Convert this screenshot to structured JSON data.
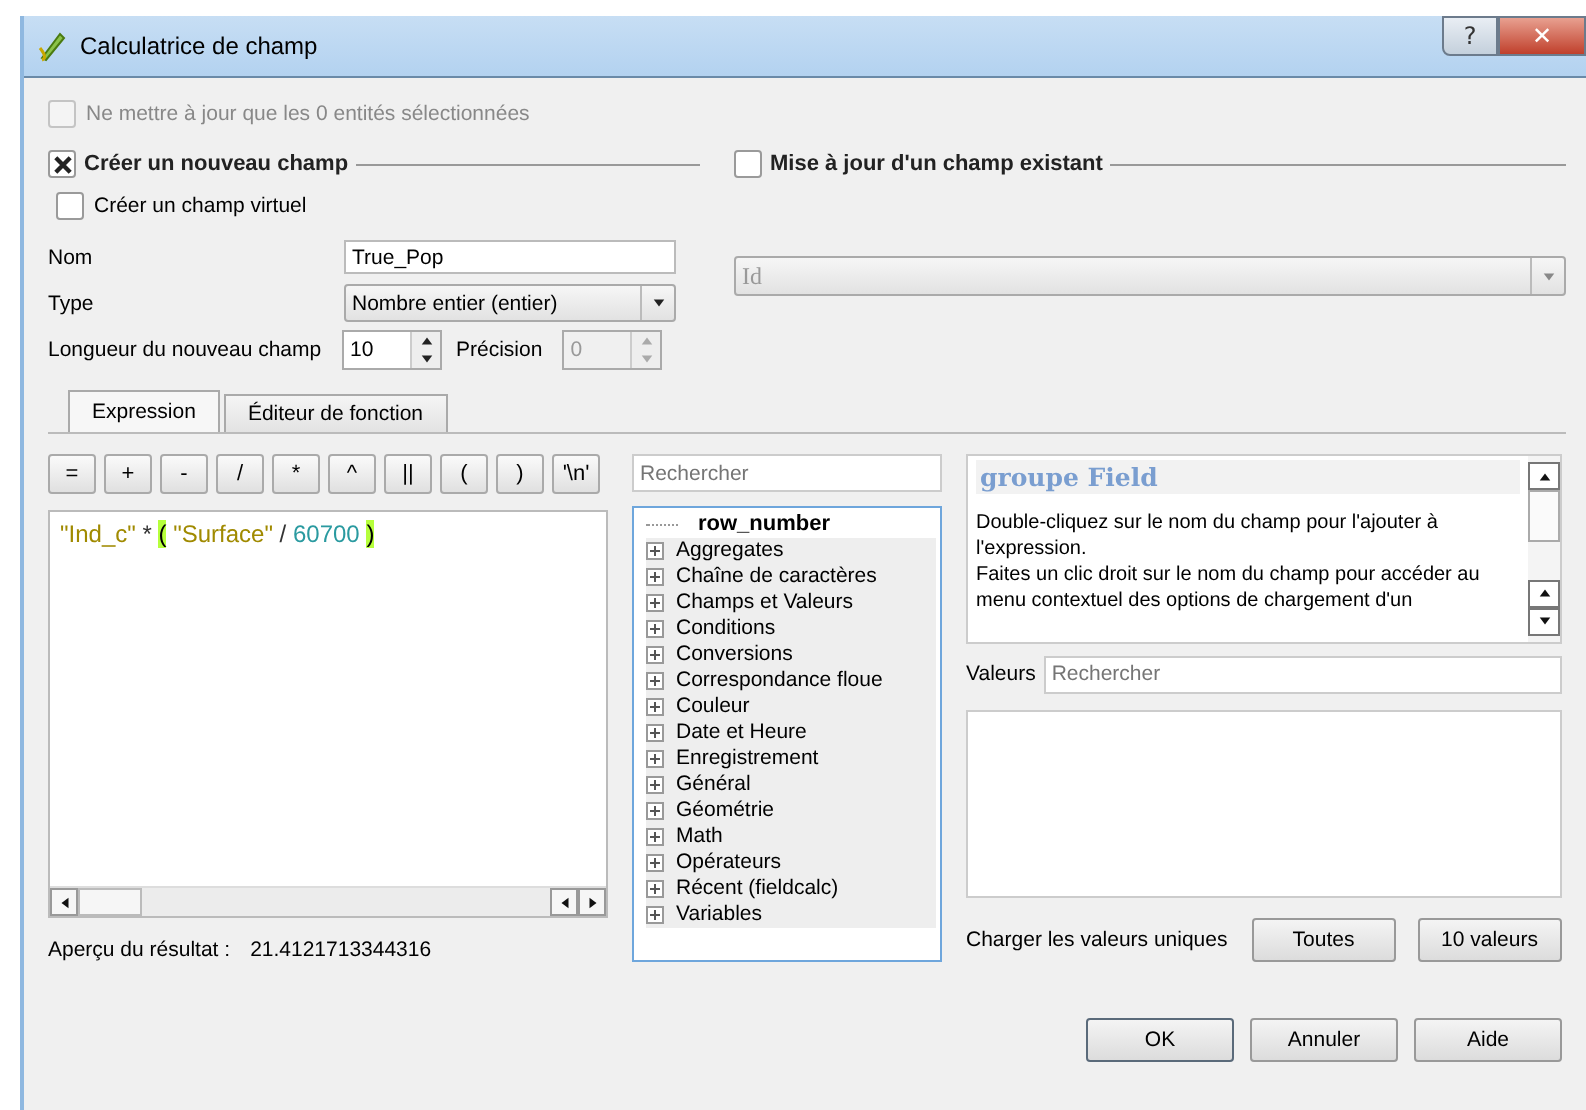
{
  "window": {
    "title": "Calculatrice de champ",
    "buttons": [
      {
        "kind": "help",
        "label": "?"
      },
      {
        "kind": "close",
        "label": "✕"
      }
    ]
  },
  "selected_only": {
    "label": "Ne mettre à jour que les 0 entités sélectionnées",
    "checked": false,
    "disabled": true
  },
  "new_field": {
    "label": "Créer un nouveau champ",
    "checked": true,
    "virtual": {
      "label": "Créer un champ virtuel",
      "checked": false
    },
    "name": {
      "label": "Nom",
      "value": "True_Pop"
    },
    "type": {
      "label": "Type",
      "value": "Nombre entier (entier)"
    },
    "length": {
      "label": "Longueur du nouveau champ",
      "value": "10"
    },
    "precision": {
      "label": "Précision",
      "value": "0",
      "disabled": true
    }
  },
  "update_field": {
    "label": "Mise à jour d'un champ existant",
    "checked": false,
    "field": {
      "value": "Id",
      "disabled": true
    }
  },
  "tabs": [
    {
      "label": "Expression",
      "selected": true
    },
    {
      "label": "Éditeur de fonction",
      "selected": false
    }
  ],
  "operators": [
    "=",
    "+",
    "-",
    "/",
    "*",
    "^",
    "||",
    "(",
    ")",
    "'\\n'"
  ],
  "expression": [
    {
      "kind": "field",
      "text": "\"Ind_c\""
    },
    {
      "kind": "op",
      "text": "*"
    },
    {
      "kind": "paren",
      "text": "("
    },
    {
      "kind": "field",
      "text": "\"Surface\""
    },
    {
      "kind": "op",
      "text": "/"
    },
    {
      "kind": "number",
      "text": "60700"
    },
    {
      "kind": "paren",
      "text": ")"
    }
  ],
  "preview": {
    "label": "Aperçu du résultat :",
    "value": "21.4121713344316"
  },
  "function_search": {
    "placeholder": "Rechercher"
  },
  "function_tree": [
    {
      "label": "row_number",
      "kind": "leaf"
    },
    {
      "label": "Aggregates",
      "kind": "group"
    },
    {
      "label": "Chaîne de caractères",
      "kind": "group"
    },
    {
      "label": "Champs et Valeurs",
      "kind": "group"
    },
    {
      "label": "Conditions",
      "kind": "group"
    },
    {
      "label": "Conversions",
      "kind": "group"
    },
    {
      "label": "Correspondance floue",
      "kind": "group"
    },
    {
      "label": "Couleur",
      "kind": "group"
    },
    {
      "label": "Date et Heure",
      "kind": "group"
    },
    {
      "label": "Enregistrement",
      "kind": "group"
    },
    {
      "label": "Général",
      "kind": "group"
    },
    {
      "label": "Géométrie",
      "kind": "group"
    },
    {
      "label": "Math",
      "kind": "group"
    },
    {
      "label": "Opérateurs",
      "kind": "group"
    },
    {
      "label": "Récent (fieldcalc)",
      "kind": "group"
    },
    {
      "label": "Variables",
      "kind": "group"
    }
  ],
  "help": {
    "title": "groupe Field",
    "lines": [
      "Double-cliquez sur le nom du champ pour l'ajouter à l'expression.",
      "Faites un clic droit sur le nom du champ pour accéder au menu contextuel des options de chargement d'un"
    ]
  },
  "values": {
    "label": "Valeurs",
    "placeholder": "Rechercher",
    "load_label": "Charger les valeurs uniques",
    "buttons": [
      "Toutes",
      "10 valeurs"
    ]
  },
  "dialog_buttons": [
    {
      "label": "OK",
      "default": true
    },
    {
      "label": "Annuler",
      "default": false
    },
    {
      "label": "Aide",
      "default": false
    }
  ]
}
